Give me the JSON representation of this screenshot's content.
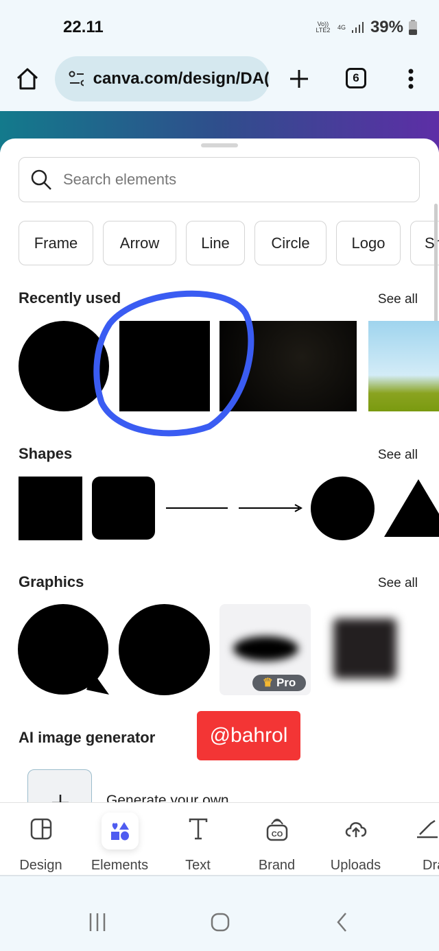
{
  "status_bar": {
    "time": "22.11",
    "network_volte": "Vo)) LTE2",
    "network_type": "4G",
    "battery": "39%"
  },
  "browser": {
    "url": "canva.com/design/DA(",
    "tab_count": "6"
  },
  "search": {
    "placeholder": "Search elements"
  },
  "chips": [
    "Frame",
    "Arrow",
    "Line",
    "Circle",
    "Logo",
    "Sh"
  ],
  "sections": {
    "recent": {
      "title": "Recently used",
      "see_all": "See all"
    },
    "shapes": {
      "title": "Shapes",
      "see_all": "See all"
    },
    "graphics": {
      "title": "Graphics",
      "see_all": "See all",
      "pro_badge": "Pro"
    },
    "ai": {
      "title": "AI image generator",
      "generate": "Generate your own"
    }
  },
  "watermark": "@bahrol",
  "bottom_nav": [
    {
      "label": "Design",
      "icon": "layout-icon"
    },
    {
      "label": "Elements",
      "icon": "elements-icon",
      "active": true
    },
    {
      "label": "Text",
      "icon": "text-icon"
    },
    {
      "label": "Brand",
      "icon": "brand-icon"
    },
    {
      "label": "Uploads",
      "icon": "upload-cloud-icon"
    },
    {
      "label": "Dra",
      "icon": "draw-icon"
    }
  ],
  "colors": {
    "accent": "#4f5cf0",
    "annotation": "#3a5cf2",
    "watermark_bg": "#f33535"
  }
}
